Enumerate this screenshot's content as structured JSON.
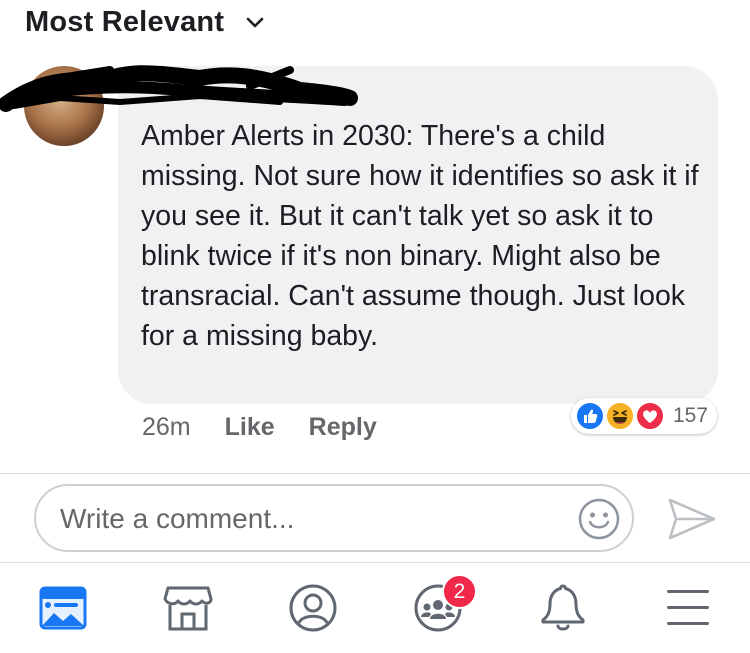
{
  "sort": {
    "label": "Most Relevant"
  },
  "comment": {
    "text": "Amber Alerts in 2030: There's a child missing. Not sure how it identifies so ask it if you see it. But it can't talk yet so ask it to blink twice if it's non binary. Might also be transracial. Can't assume though. Just look for a missing baby.",
    "time": "26m",
    "like_label": "Like",
    "reply_label": "Reply",
    "reaction_count": "157",
    "reactions": [
      "like-icon",
      "haha-icon",
      "love-icon"
    ]
  },
  "composer": {
    "placeholder": "Write a comment..."
  },
  "tabbar": {
    "items": [
      "news-feed-icon",
      "marketplace-icon",
      "profile-icon",
      "groups-icon",
      "notifications-icon",
      "menu-icon"
    ],
    "groups_badge": "2"
  },
  "colors": {
    "accent": "#1877f2",
    "badge": "#f02849",
    "bubble": "#f0f1f3"
  }
}
